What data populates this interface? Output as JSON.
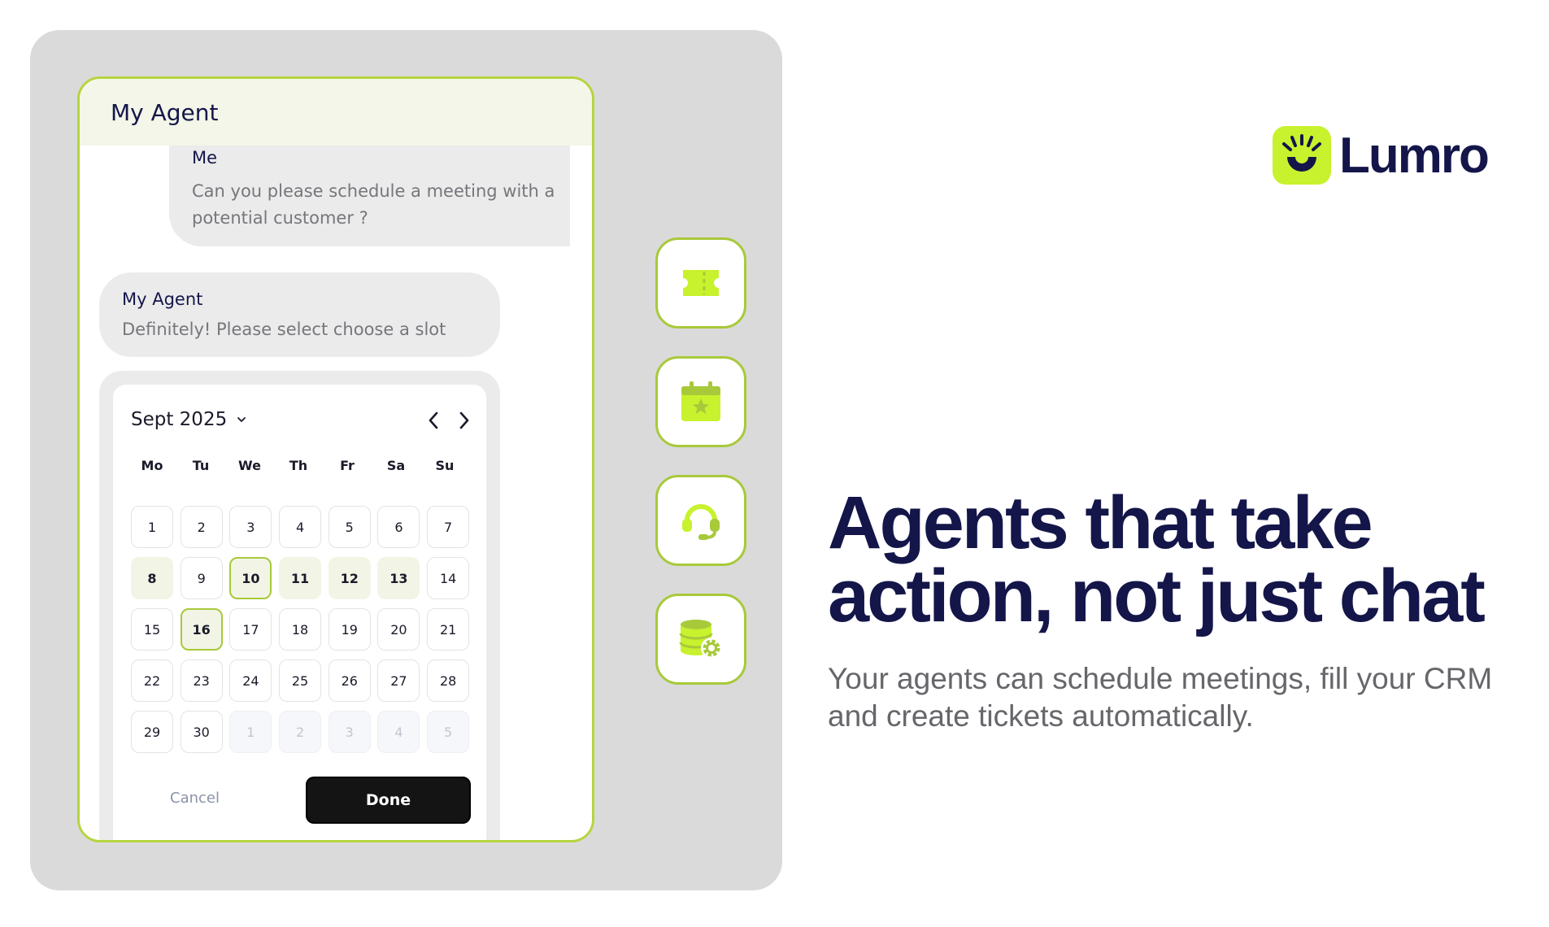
{
  "chat": {
    "title": "My Agent",
    "messages": [
      {
        "sender": "Me",
        "text": "Can you please schedule a meeting with a potential customer  ?"
      },
      {
        "sender": "My Agent",
        "text": "Definitely! Please select choose a slot"
      }
    ]
  },
  "calendar": {
    "month_label": "Sept 2025",
    "weekdays": [
      "Mo",
      "Tu",
      "We",
      "Th",
      "Fr",
      "Sa",
      "Su"
    ],
    "days": [
      {
        "label": "1",
        "state": "normal"
      },
      {
        "label": "2",
        "state": "normal"
      },
      {
        "label": "3",
        "state": "normal"
      },
      {
        "label": "4",
        "state": "normal"
      },
      {
        "label": "5",
        "state": "normal"
      },
      {
        "label": "6",
        "state": "normal"
      },
      {
        "label": "7",
        "state": "normal"
      },
      {
        "label": "8",
        "state": "available"
      },
      {
        "label": "9",
        "state": "normal"
      },
      {
        "label": "10",
        "state": "selected"
      },
      {
        "label": "11",
        "state": "available"
      },
      {
        "label": "12",
        "state": "available"
      },
      {
        "label": "13",
        "state": "available"
      },
      {
        "label": "14",
        "state": "normal"
      },
      {
        "label": "15",
        "state": "normal"
      },
      {
        "label": "16",
        "state": "selected"
      },
      {
        "label": "17",
        "state": "normal"
      },
      {
        "label": "18",
        "state": "normal"
      },
      {
        "label": "19",
        "state": "normal"
      },
      {
        "label": "20",
        "state": "normal"
      },
      {
        "label": "21",
        "state": "normal"
      },
      {
        "label": "22",
        "state": "normal"
      },
      {
        "label": "23",
        "state": "normal"
      },
      {
        "label": "24",
        "state": "normal"
      },
      {
        "label": "25",
        "state": "normal"
      },
      {
        "label": "26",
        "state": "normal"
      },
      {
        "label": "27",
        "state": "normal"
      },
      {
        "label": "28",
        "state": "normal"
      },
      {
        "label": "29",
        "state": "normal"
      },
      {
        "label": "30",
        "state": "normal"
      },
      {
        "label": "1",
        "state": "muted"
      },
      {
        "label": "2",
        "state": "muted"
      },
      {
        "label": "3",
        "state": "muted"
      },
      {
        "label": "4",
        "state": "muted"
      },
      {
        "label": "5",
        "state": "muted"
      }
    ],
    "cancel_label": "Cancel",
    "done_label": "Done"
  },
  "tools": [
    {
      "name": "ticket-icon"
    },
    {
      "name": "calendar-star-icon"
    },
    {
      "name": "headset-icon"
    },
    {
      "name": "database-gear-icon"
    }
  ],
  "brand": {
    "name": "Lumro",
    "accent": "#c7f22d",
    "border_accent": "#a8c93a",
    "navy": "#14164a"
  },
  "hero": {
    "headline_line1": "Agents that take",
    "headline_line2": "action, not just chat",
    "subtitle": "Your agents can schedule meetings, fill your CRM and create tickets automatically."
  }
}
